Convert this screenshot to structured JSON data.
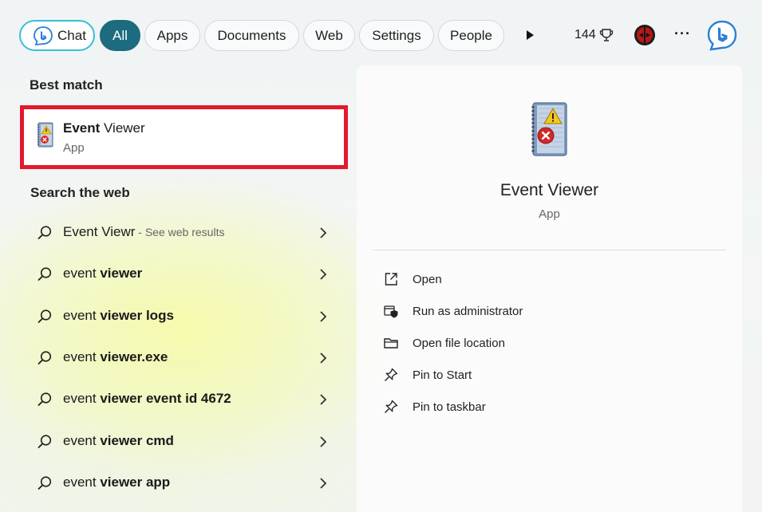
{
  "filters": {
    "chat": "Chat",
    "all": "All",
    "apps": "Apps",
    "documents": "Documents",
    "web": "Web",
    "settings": "Settings",
    "people": "People"
  },
  "rewards": {
    "points": "144"
  },
  "colors": {
    "accent": "#1d6b7f",
    "chat_border": "#38bfd6",
    "highlight": "#e3192d"
  },
  "best_match": {
    "heading": "Best match",
    "name_bold": "Event",
    "name_rest": " Viewer",
    "type": "App"
  },
  "web_search": {
    "heading": "Search the web",
    "items": [
      {
        "plain": "Event Viewr",
        "bold": "",
        "suffix": " - See web results"
      },
      {
        "plain": "event ",
        "bold": "viewer",
        "suffix": ""
      },
      {
        "plain": "event ",
        "bold": "viewer logs",
        "suffix": ""
      },
      {
        "plain": "event ",
        "bold": "viewer.exe",
        "suffix": ""
      },
      {
        "plain": "event ",
        "bold": "viewer event id 4672",
        "suffix": ""
      },
      {
        "plain": "event ",
        "bold": "viewer cmd",
        "suffix": ""
      },
      {
        "plain": "event ",
        "bold": "viewer app",
        "suffix": ""
      }
    ]
  },
  "preview": {
    "title": "Event Viewer",
    "type": "App",
    "actions": [
      {
        "label": "Open",
        "icon": "open-external-icon"
      },
      {
        "label": "Run as administrator",
        "icon": "shield-icon"
      },
      {
        "label": "Open file location",
        "icon": "folder-icon"
      },
      {
        "label": "Pin to Start",
        "icon": "pin-icon"
      },
      {
        "label": "Pin to taskbar",
        "icon": "pin-icon"
      }
    ]
  }
}
